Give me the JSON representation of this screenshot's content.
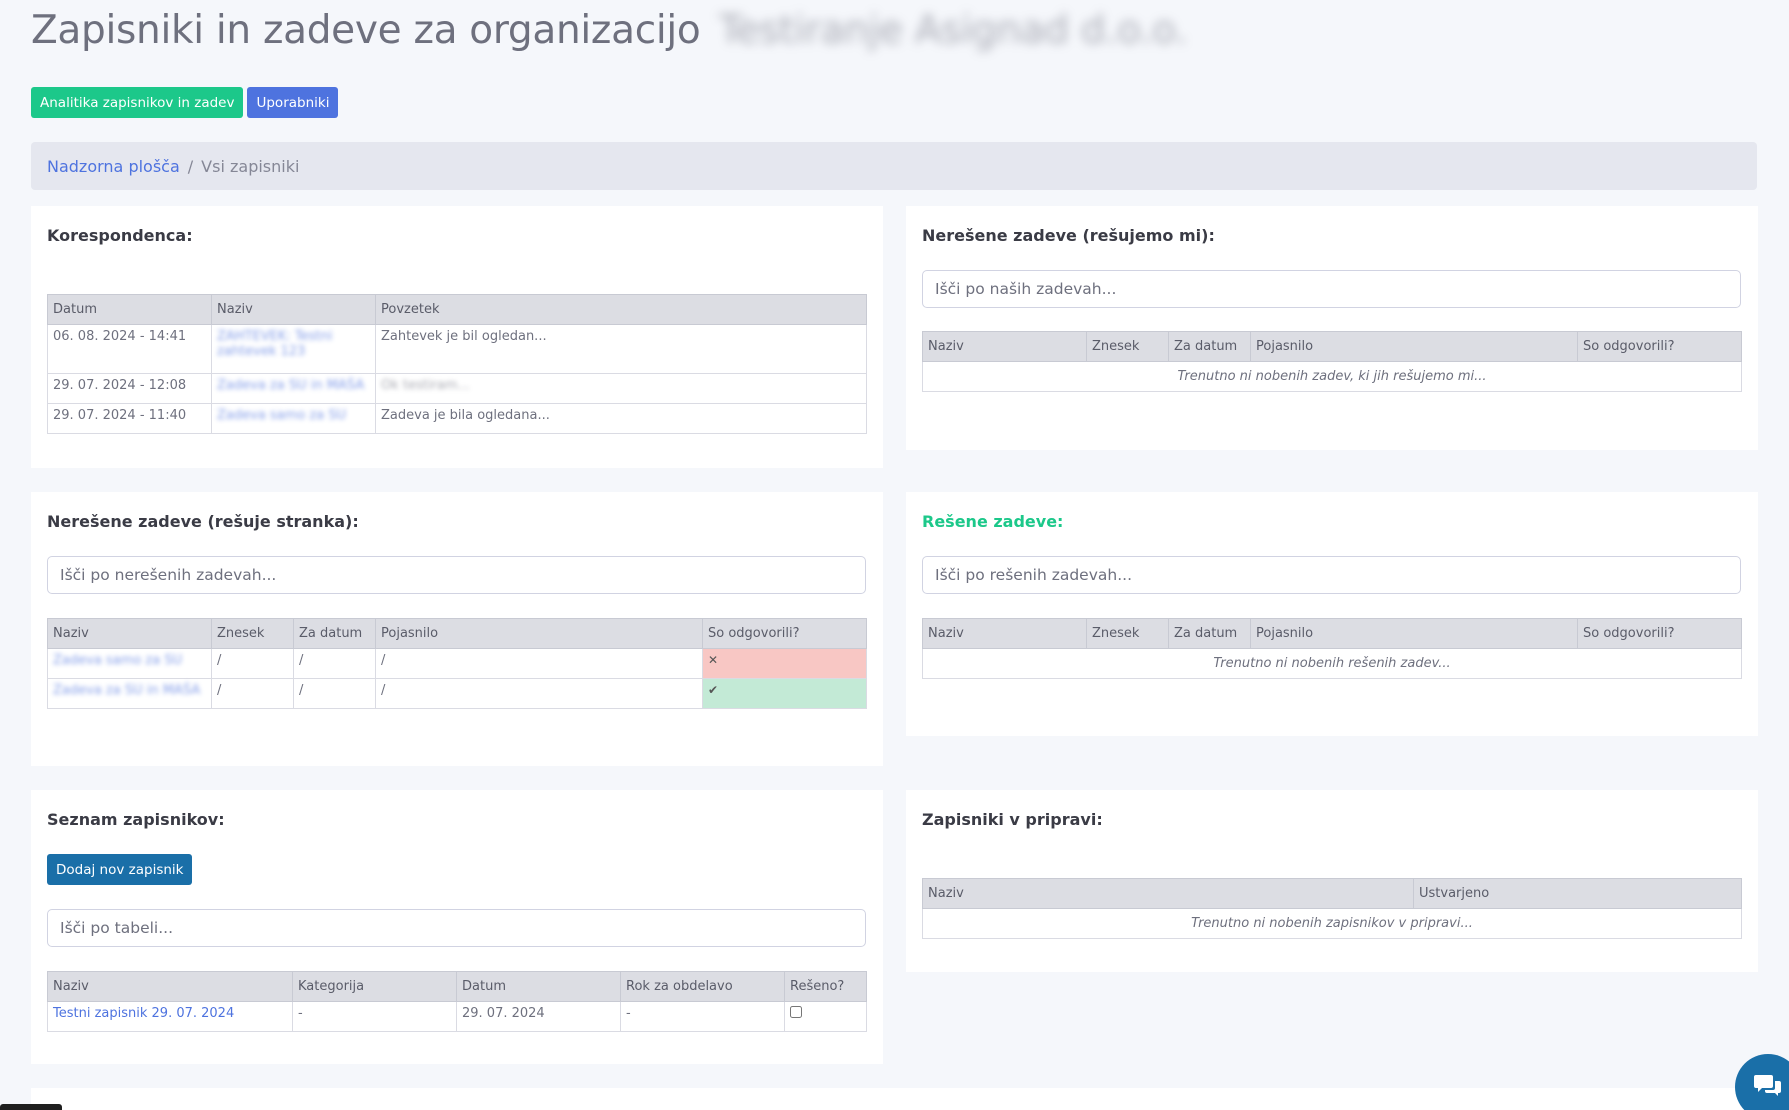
{
  "header": {
    "title": "Zapisniki in zadeve za organizacijo",
    "organization": "Testiranje Asignad d.o.o."
  },
  "top_buttons": {
    "analytics": "Analitika zapisnikov in zadev",
    "users": "Uporabniki"
  },
  "breadcrumb": {
    "home": "Nadzorna plošča",
    "separator": "/",
    "current": "Vsi zapisniki"
  },
  "correspondence": {
    "title": "Korespondenca:",
    "headers": [
      "Datum",
      "Naziv",
      "Povzetek"
    ],
    "rows": [
      {
        "date": "06. 08. 2024 - 14:41",
        "name": "ZAHTEVEK: Testni zahtevek 123",
        "summary": "Zahtevek je bil ogledan..."
      },
      {
        "date": "29. 07. 2024 - 12:08",
        "name": "Zadeva za SU in MAŠA",
        "summary": "Ok testiram..."
      },
      {
        "date": "29. 07. 2024 - 11:40",
        "name": "Zadeva samo za SU",
        "summary": "Zadeva je bila ogledana..."
      }
    ]
  },
  "unresolved_ours": {
    "title": "Nerešene zadeve (rešujemo mi):",
    "search_placeholder": "Išči po naših zadevah...",
    "headers": [
      "Naziv",
      "Znesek",
      "Za datum",
      "Pojasnilo",
      "So odgovorili?"
    ],
    "empty": "Trenutno ni nobenih zadev, ki jih rešujemo mi..."
  },
  "unresolved_client": {
    "title": "Nerešene zadeve (rešuje stranka):",
    "search_placeholder": "Išči po nerešenih zadevah...",
    "headers": [
      "Naziv",
      "Znesek",
      "Za datum",
      "Pojasnilo",
      "So odgovorili?"
    ],
    "rows": [
      {
        "name": "Zadeva samo za SU",
        "amount": "/",
        "date": "/",
        "note": "/",
        "answered": "no",
        "answered_icon": "times-icon",
        "answered_symbol": "✕"
      },
      {
        "name": "Zadeva za SU in MAŠA",
        "amount": "/",
        "date": "/",
        "note": "/",
        "answered": "yes",
        "answered_icon": "check-icon",
        "answered_symbol": "✔"
      }
    ]
  },
  "resolved": {
    "title": "Rešene zadeve:",
    "search_placeholder": "Išči po rešenih zadevah...",
    "headers": [
      "Naziv",
      "Znesek",
      "Za datum",
      "Pojasnilo",
      "So odgovorili?"
    ],
    "empty": "Trenutno ni nobenih rešenih zadev..."
  },
  "minutes_list": {
    "title": "Seznam zapisnikov:",
    "add_button": "Dodaj nov zapisnik",
    "search_placeholder": "Išči po tabeli...",
    "headers": [
      "Naziv",
      "Kategorija",
      "Datum",
      "Rok za obdelavo",
      "Rešeno?"
    ],
    "rows": [
      {
        "name": "Testni zapisnik 29. 07. 2024",
        "category": "-",
        "date": "29. 07. 2024",
        "deadline": "-",
        "resolved": false
      }
    ]
  },
  "drafts": {
    "title": "Zapisniki v pripravi:",
    "headers": [
      "Naziv",
      "Ustvarjeno"
    ],
    "empty": "Trenutno ni nobenih zapisnikov v pripravi..."
  },
  "colors": {
    "primary": "#4e73df",
    "success": "#1cc88a",
    "dark_button": "#1a6fa8",
    "danger_cell": "#f8c7c4",
    "success_cell": "#c3ead6"
  }
}
